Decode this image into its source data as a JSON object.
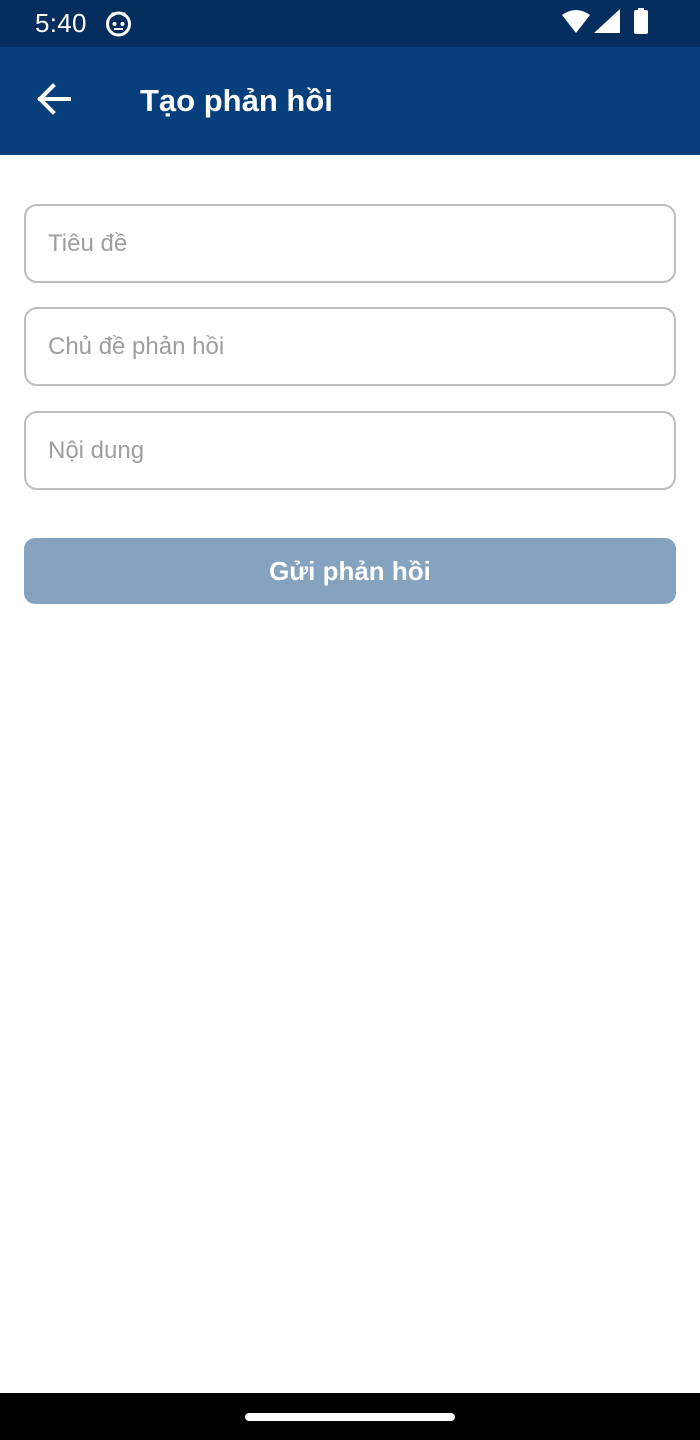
{
  "status_bar": {
    "time": "5:40",
    "app_icon": "cat-face-icon",
    "icons": [
      "wifi-icon",
      "signal-icon",
      "battery-icon"
    ]
  },
  "app_bar": {
    "back_icon": "arrow-left-icon",
    "title": "Tạo phản hồi"
  },
  "form": {
    "title_field": {
      "value": "",
      "placeholder": "Tiêu đề"
    },
    "topic_field": {
      "value": "",
      "placeholder": "Chủ đề phản hồi"
    },
    "content_field": {
      "value": "",
      "placeholder": "Nội dung"
    },
    "submit_label": "Gửi phản hồi"
  },
  "colors": {
    "status_bar": "#052d5e",
    "app_bar": "#063f7c",
    "button_disabled": "#85a2bf",
    "field_border": "#bdbdbd",
    "placeholder": "#9e9e9e"
  }
}
